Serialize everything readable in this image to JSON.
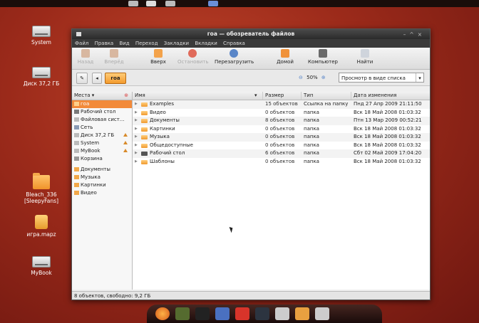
{
  "desktop": {
    "icons": [
      {
        "label": "System"
      },
      {
        "label": "Диск 37,2 ГБ"
      },
      {
        "label": "Bleach_336 [SleepyFans]"
      },
      {
        "label": "игра.mapz"
      },
      {
        "label": "MyBook"
      }
    ]
  },
  "window": {
    "title": "гоа — обозреватель файлов",
    "menu": [
      "Файл",
      "Правка",
      "Вид",
      "Переход",
      "Закладки",
      "Вкладки",
      "Справка"
    ],
    "toolbar": {
      "back": "Назад",
      "forward": "Вперёд",
      "up": "Вверх",
      "stop": "Остановить",
      "reload": "Перезагрузить",
      "home": "Домой",
      "computer": "Компьютер",
      "search": "Найти"
    },
    "location": {
      "crumb": "гоа",
      "zoom": "50%",
      "view_mode": "Просмотр в виде списка"
    },
    "sidebar": {
      "header": "Места ▾",
      "places": [
        {
          "label": "гоа",
          "selected": true
        },
        {
          "label": "Рабочий стол"
        },
        {
          "label": "Файловая сист..."
        },
        {
          "label": "Сеть"
        },
        {
          "label": "Диск 37,2 ГБ"
        },
        {
          "label": "System"
        },
        {
          "label": "MyBook"
        },
        {
          "label": "Корзина"
        }
      ],
      "bookmarks": [
        {
          "label": "Документы"
        },
        {
          "label": "Музыка"
        },
        {
          "label": "Картинки"
        },
        {
          "label": "Видео"
        }
      ]
    },
    "columns": {
      "name": "Имя",
      "size": "Размер",
      "type": "Тип",
      "modified": "Дата изменения"
    },
    "files": [
      {
        "name": "Examples",
        "size": "15 объектов",
        "type": "Ссылка на папку",
        "modified": "Пнд 27 Апр 2009 21:11:50"
      },
      {
        "name": "Видео",
        "size": "0 объектов",
        "type": "папка",
        "modified": "Вск 18 Май 2008 01:03:32"
      },
      {
        "name": "Документы",
        "size": "8 объектов",
        "type": "папка",
        "modified": "Птн 13 Мар 2009 00:52:21"
      },
      {
        "name": "Картинки",
        "size": "0 объектов",
        "type": "папка",
        "modified": "Вск 18 Май 2008 01:03:32"
      },
      {
        "name": "Музыка",
        "size": "0 объектов",
        "type": "папка",
        "modified": "Вск 18 Май 2008 01:03:32"
      },
      {
        "name": "Общедоступные",
        "size": "0 объектов",
        "type": "папка",
        "modified": "Вск 18 Май 2008 01:03:32"
      },
      {
        "name": "Рабочий стол",
        "size": "6 объектов",
        "type": "папка",
        "modified": "Сбт 02 Май 2009 17:04:20"
      },
      {
        "name": "Шаблоны",
        "size": "0 объектов",
        "type": "папка",
        "modified": "Вск 18 Май 2008 01:03:32"
      }
    ],
    "status": "8 объектов, свободно: 9,2 ГБ"
  },
  "colors": {
    "accent": "#f28a3a",
    "desktop_bg": "#9b2a1a"
  }
}
